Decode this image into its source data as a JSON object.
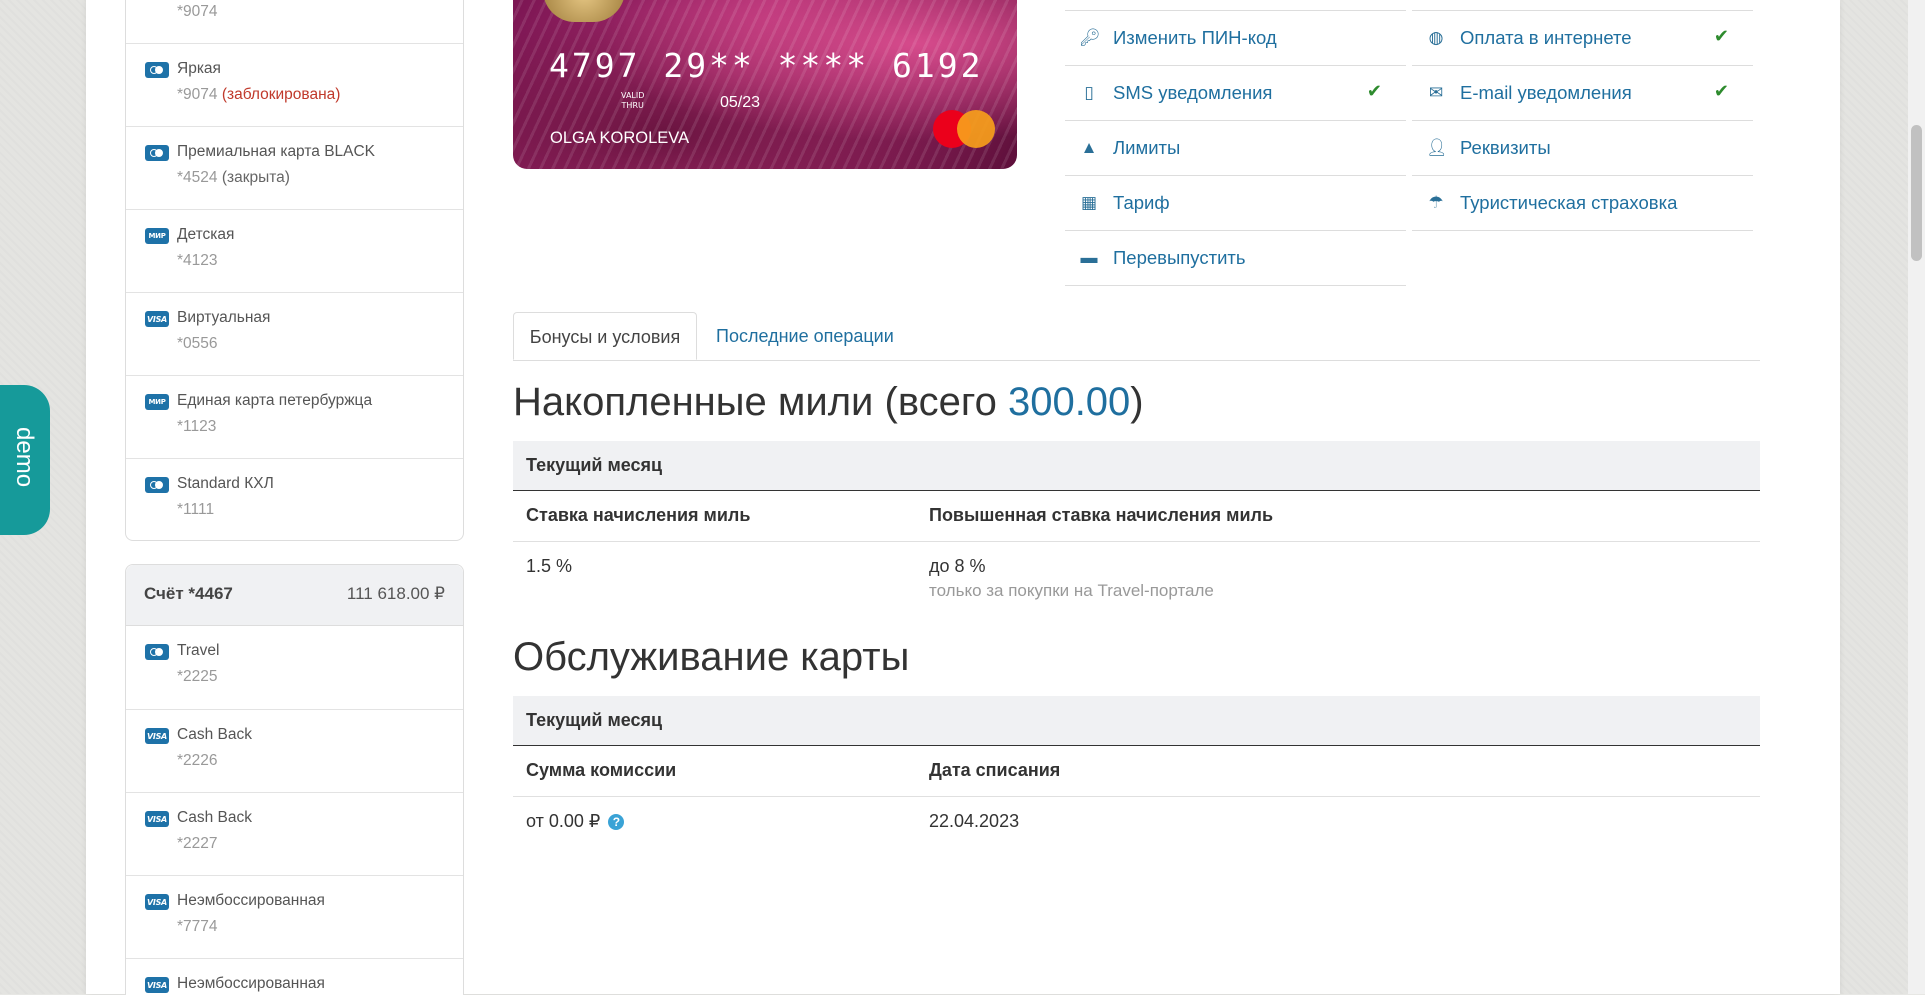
{
  "cards_top": [
    {
      "name": "",
      "number": "*9074",
      "status": "",
      "logo": "mastercard"
    },
    {
      "name": "Яркая",
      "number": "*9074",
      "status": "(заблокирована)",
      "status_type": "red",
      "logo": "mastercard"
    },
    {
      "name": "Премиальная карта BLACK",
      "number": "*4524",
      "status": "(закрыта)",
      "status_type": "gray",
      "logo": "mastercard"
    },
    {
      "name": "Детская",
      "number": "*4123",
      "status": "",
      "logo": "mir"
    },
    {
      "name": "Виртуальная",
      "number": "*0556",
      "status": "",
      "logo": "visa"
    },
    {
      "name": "Единая карта петербуржца",
      "number": "*1123",
      "status": "",
      "logo": "mir"
    },
    {
      "name": "Standard КХЛ",
      "number": "*1111",
      "status": "",
      "logo": "mastercard"
    }
  ],
  "account": {
    "title": "Счёт *4467",
    "balance": "111 618.00 ₽"
  },
  "cards_bottom": [
    {
      "name": "Travel",
      "number": "*2225",
      "logo": "mastercard"
    },
    {
      "name": "Cash Back",
      "number": "*2226",
      "logo": "visa"
    },
    {
      "name": "Cash Back",
      "number": "*2227",
      "logo": "visa"
    },
    {
      "name": "Неэмбоссированная",
      "number": "*7774",
      "logo": "visa"
    },
    {
      "name": "Неэмбоссированная",
      "number": "",
      "logo": "visa"
    }
  ],
  "logos": {
    "mir": "МИР",
    "visa": "VISA"
  },
  "demo_label": "demo",
  "card_image": {
    "number": "4797 29** **** 6192",
    "valid_thru": "VALID\nTHRU",
    "expiry": "05/23",
    "holder": "OLGA KOROLEVA"
  },
  "actions": [
    {
      "label": "Изменить ПИН-код",
      "icon": "key-icon",
      "checked": false
    },
    {
      "label": "Оплата в интернете",
      "icon": "globe-icon",
      "checked": true
    },
    {
      "label": "SMS уведомления",
      "icon": "mobile-icon",
      "checked": true
    },
    {
      "label": "E-mail уведомления",
      "icon": "envelope-icon",
      "checked": true
    },
    {
      "label": "Лимиты",
      "icon": "warning-icon",
      "checked": false
    },
    {
      "label": "Реквизиты",
      "icon": "user-icon",
      "checked": false
    },
    {
      "label": "Тариф",
      "icon": "calculator-icon",
      "checked": false
    },
    {
      "label": "Туристическая страховка",
      "icon": "umbrella-icon",
      "checked": false
    },
    {
      "label": "Перевыпустить",
      "icon": "card-icon",
      "checked": false
    }
  ],
  "check_mark": "✔",
  "tabs": {
    "active": "Бонусы и условия",
    "other": "Последние операции"
  },
  "miles": {
    "heading_prefix": "Накопленные мили (всего ",
    "heading_value": "300.00",
    "heading_suffix": ")",
    "period": "Текущий месяц",
    "col1": "Ставка начисления миль",
    "col2": "Повышенная ставка начисления миль",
    "val1": "1.5 %",
    "val2": "до 8 %",
    "val2_note": "только за покупки на Travel-портале"
  },
  "service": {
    "heading": "Обслуживание карты",
    "period": "Текущий месяц",
    "col1": "Сумма комиссии",
    "col2": "Дата списания",
    "val1": "от 0.00 ₽",
    "help": "?",
    "val2": "22.04.2023"
  },
  "colors": {
    "accent": "#1f6f9f",
    "demo": "#169a9a",
    "status_red": "#c0392b",
    "check": "#2e8b2e"
  }
}
